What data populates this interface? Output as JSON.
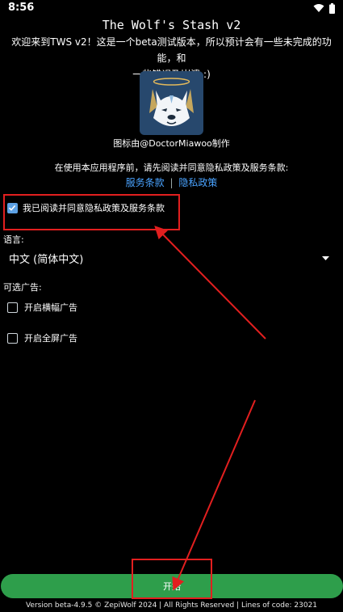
{
  "status_bar": {
    "time": "8:56"
  },
  "app": {
    "title": "The Wolf's Stash v2",
    "welcome_line1": "欢迎来到TWS v2！这是一个beta测试版本，所以预计会有一些未完成的功能，和",
    "welcome_line2": "一些错误及崩溃 :)",
    "logo_credit": "图标由@DoctorMiawoo制作"
  },
  "privacy": {
    "intro": "在使用本应用程序前，请先阅读并同意隐私政策及服务条款:",
    "terms_link": "服务条款",
    "separator": "|",
    "privacy_link": "隐私政策",
    "agree_label": "我已阅读并同意隐私政策及服务条款",
    "agree_checked": true
  },
  "language": {
    "label": "语言:",
    "selected": "中文 (简体中文)"
  },
  "ads": {
    "label": "可选广告:",
    "banner_label": "开启横幅广告",
    "banner_checked": false,
    "fullscreen_label": "开启全屏广告",
    "fullscreen_checked": false
  },
  "start_button": {
    "label": "开始"
  },
  "footer": {
    "text": "Version beta-4.9.5 © ZepiWolf 2024 | All Rights Reserved | Lines of code: 23021"
  },
  "colors": {
    "accent_green": "#2e9e4b",
    "link_blue": "#4aa3ff",
    "checkbox_blue": "#5da1e4",
    "annotation_red": "#e21f1f",
    "logo_bg": "#27486d"
  }
}
